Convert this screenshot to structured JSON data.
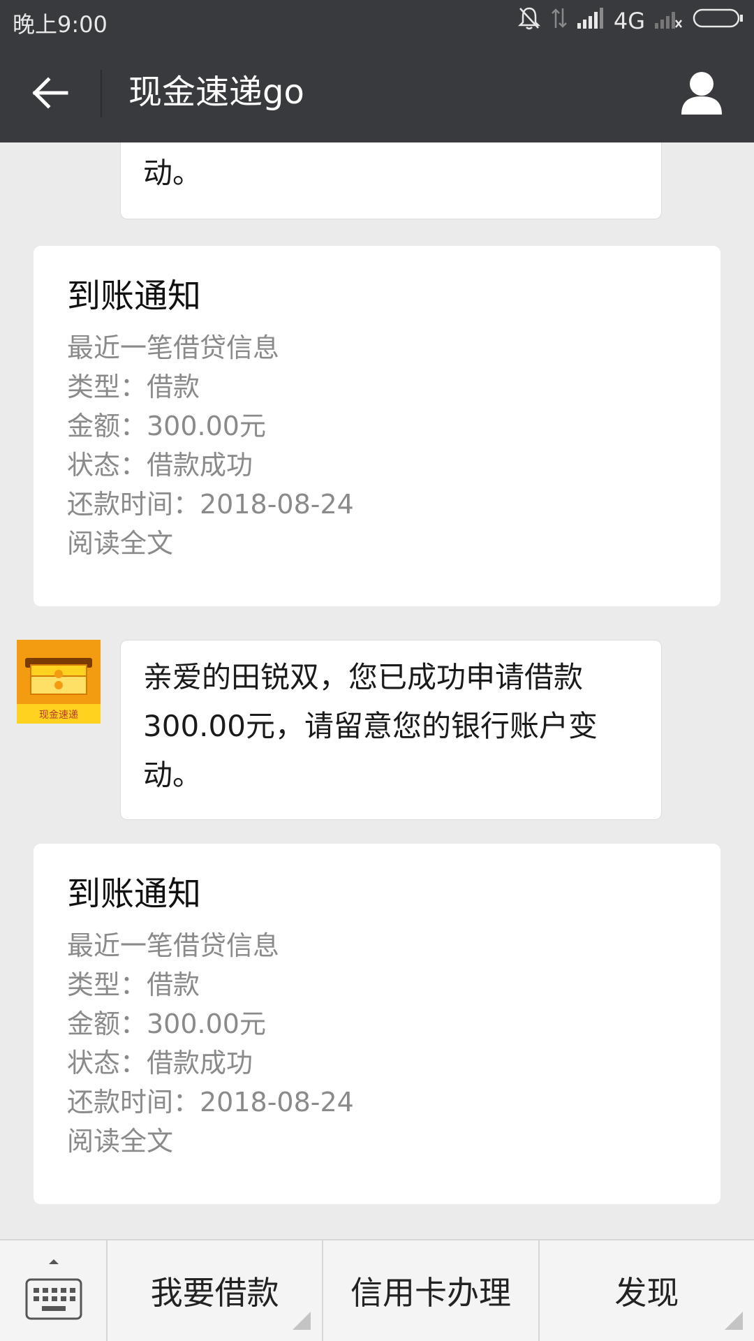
{
  "status_bar": {
    "time": "晚上9:00",
    "network": "4G"
  },
  "header": {
    "title": "现金速递go"
  },
  "messages": {
    "partial_bubble_text": "动。",
    "avatar_label": "现金速递",
    "bubble_text": "亲爱的田锐双，您已成功申请借款300.00元，请留意您的银行账户变动。",
    "cards": [
      {
        "title": "到账通知",
        "lines": [
          "最近一笔借贷信息",
          "类型：借款",
          "金额：300.00元",
          "状态：借款成功",
          "还款时间：2018-08-24",
          "阅读全文"
        ]
      },
      {
        "title": "到账通知",
        "lines": [
          "最近一笔借贷信息",
          "类型：借款",
          "金额：300.00元",
          "状态：借款成功",
          "还款时间：2018-08-24",
          "阅读全文"
        ]
      }
    ]
  },
  "menu": {
    "items": [
      "我要借款",
      "信用卡办理",
      "发现"
    ]
  },
  "colors": {
    "header_bg": "#393a3e",
    "chat_bg": "#ebebeb",
    "avatar_orange": "#f39c12",
    "avatar_yellow": "#ffd21f"
  }
}
